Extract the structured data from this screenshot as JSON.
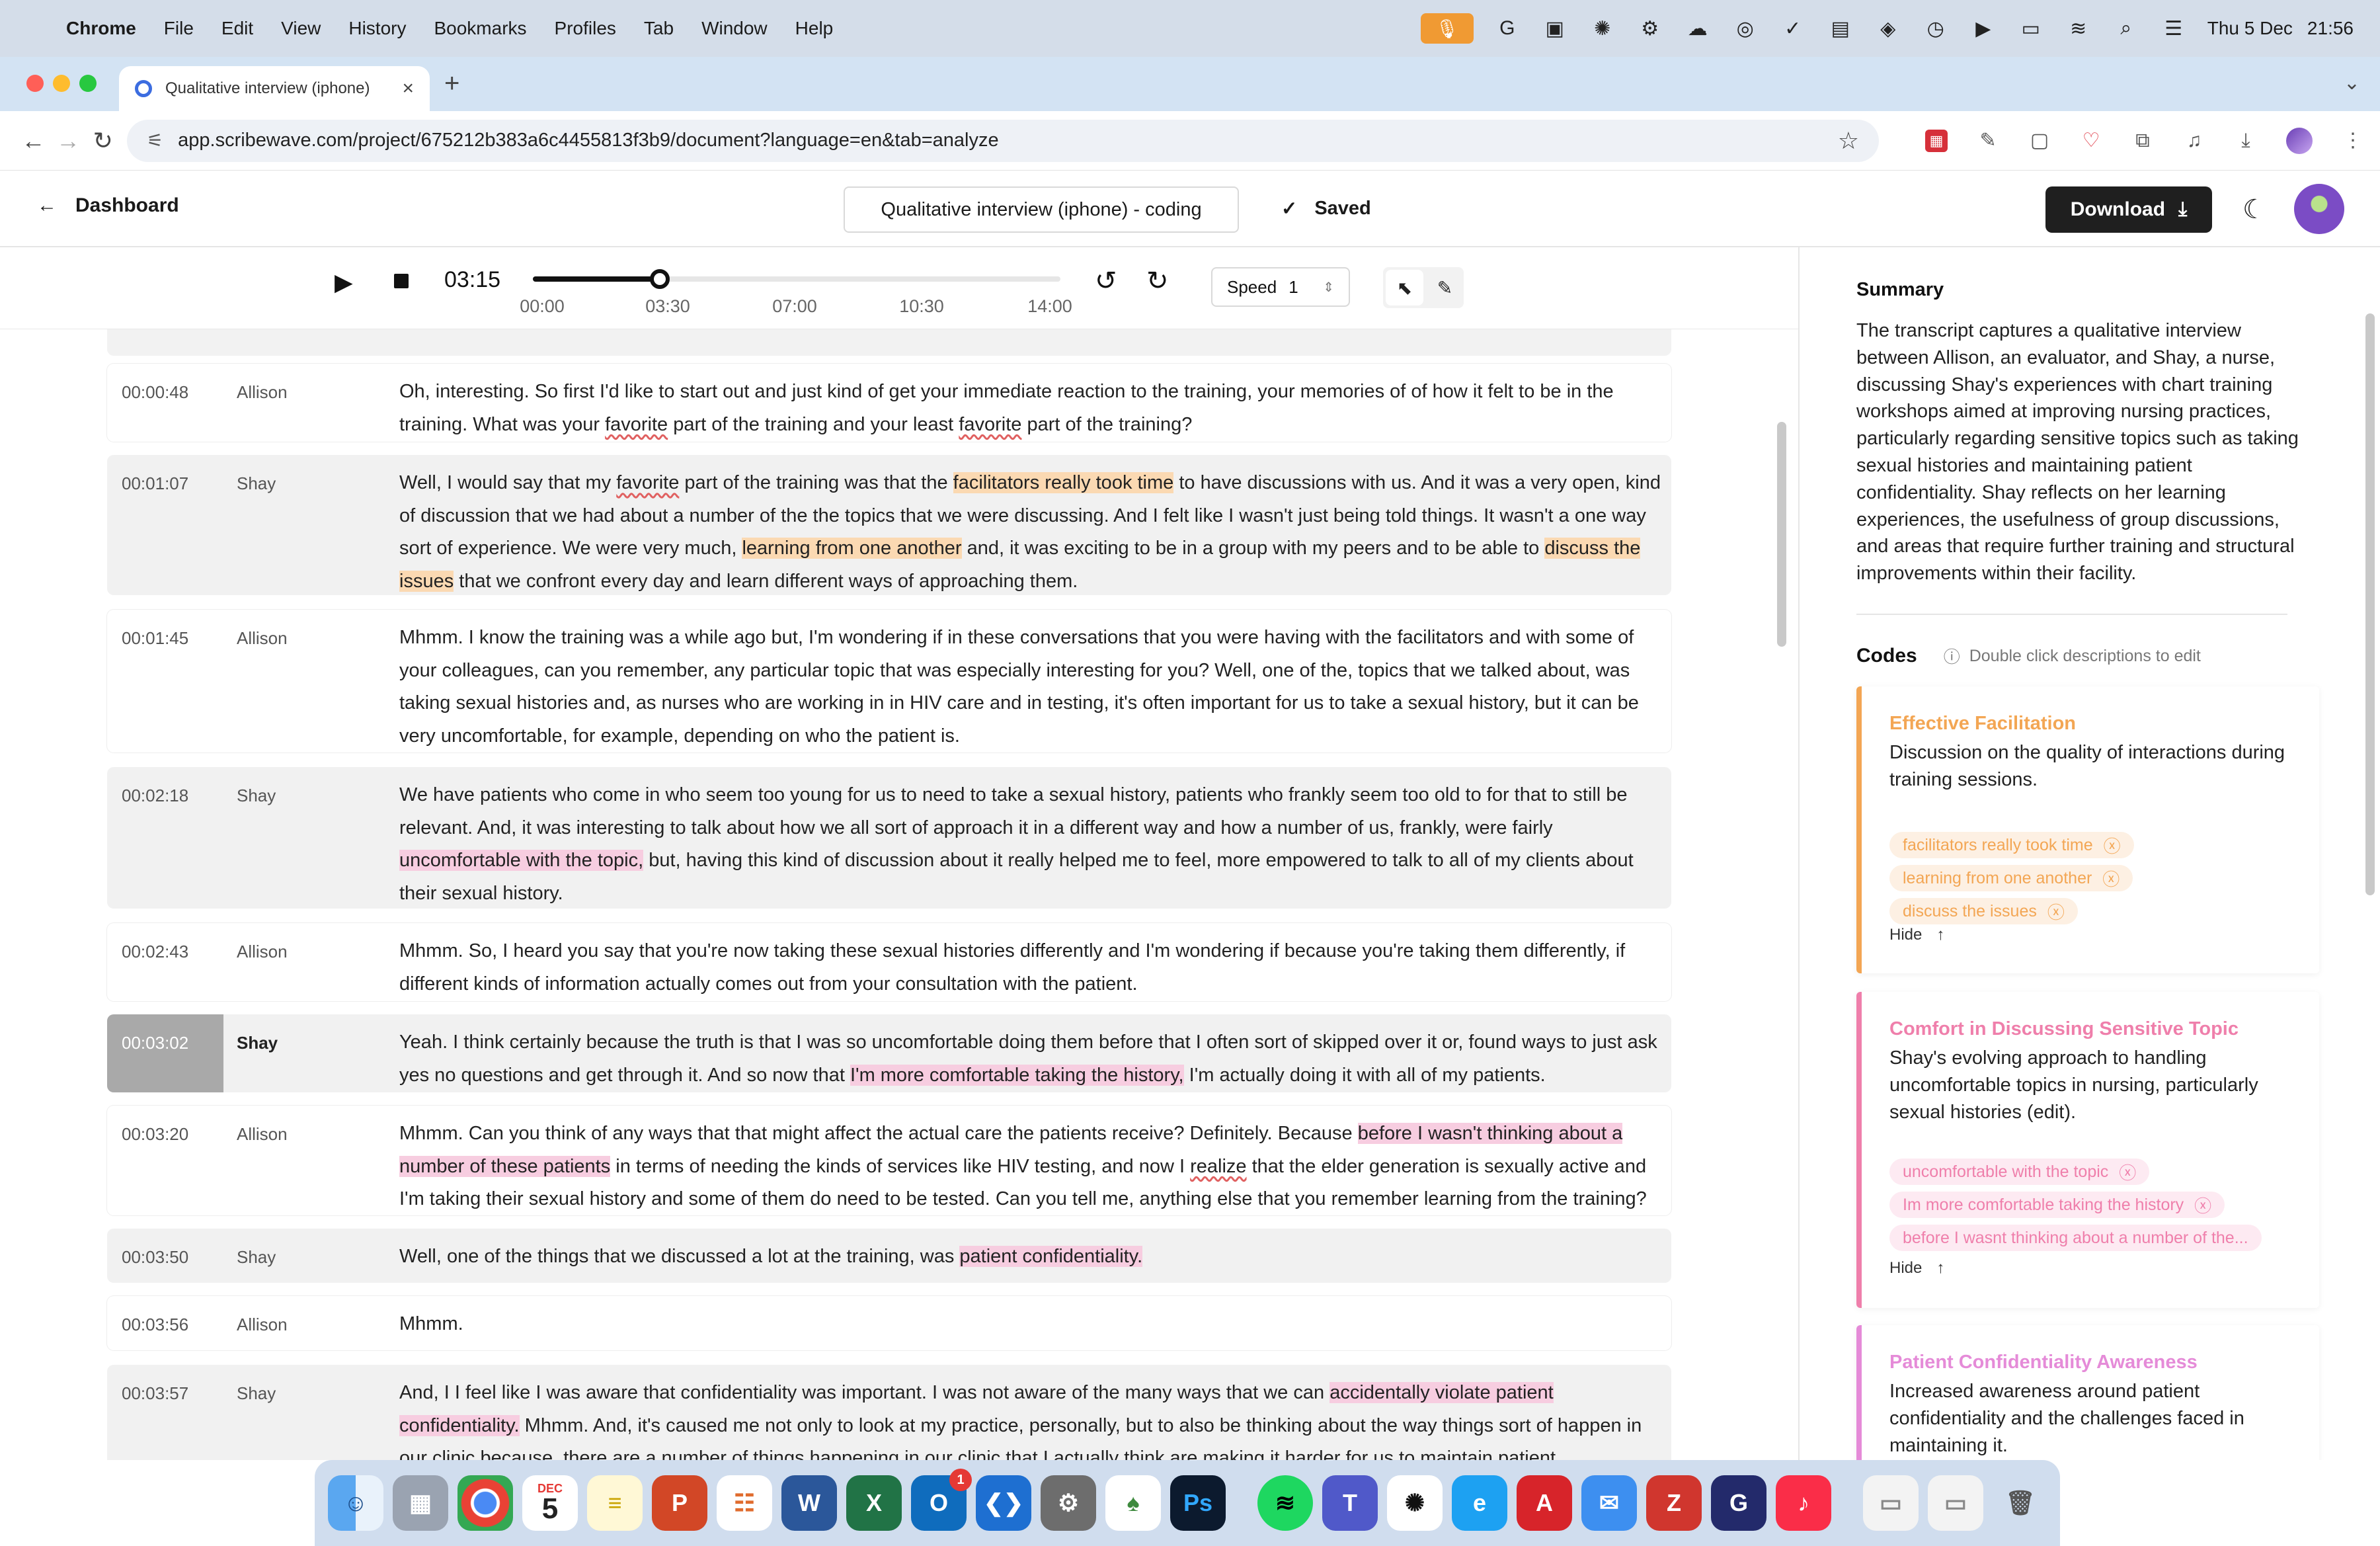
{
  "menubar": {
    "app": "Chrome",
    "items": [
      "File",
      "Edit",
      "View",
      "History",
      "Bookmarks",
      "Profiles",
      "Tab",
      "Window",
      "Help"
    ],
    "date": "Thu 5 Dec",
    "time": "21:56"
  },
  "browser": {
    "tab_title": "Qualitative interview (iphone)",
    "url": "app.scribewave.com/project/675212b383a6c4455813f3b9/document?language=en&tab=analyze"
  },
  "header": {
    "back_label": "Dashboard",
    "doc_title": "Qualitative interview (iphone) - coding",
    "saved_label": "Saved",
    "download_label": "Download"
  },
  "player": {
    "current_time": "03:15",
    "progress": 0.24,
    "ticks": [
      "00:00",
      "03:30",
      "07:00",
      "10:30",
      "14:00"
    ],
    "speed_label": "Speed",
    "speed_value": "1"
  },
  "transcript": [
    {
      "time": "00:00:48",
      "speaker": "Allison"
    },
    {
      "time": "00:01:07",
      "speaker": "Shay"
    },
    {
      "time": "00:01:45",
      "speaker": "Allison"
    },
    {
      "time": "00:02:18",
      "speaker": "Shay"
    },
    {
      "time": "00:02:43",
      "speaker": "Allison"
    },
    {
      "time": "00:03:02",
      "speaker": "Shay"
    },
    {
      "time": "00:03:20",
      "speaker": "Allison"
    },
    {
      "time": "00:03:50",
      "speaker": "Shay"
    },
    {
      "time": "00:03:56",
      "speaker": "Allison"
    },
    {
      "time": "00:03:57",
      "speaker": "Shay"
    }
  ],
  "t": {
    "r0": "Oh, interesting. So first I'd like to start out and just kind of get your immediate reaction to the training, your memories of of how it felt to be in the training. What was your ",
    "r0b": " part of the training and your least ",
    "r0c": " part of the training?",
    "favorite": "favorite",
    "r1a": "Well, I would say that my ",
    "r1b": " part of the training was that the ",
    "r1c": " to have discussions with us. And it was a very open, kind of discussion that we had about a number of the the topics that we were discussing. And I felt like I wasn't just being told things. It wasn't a one way sort of experience. We were very much, ",
    "r1d": " and, it was exciting to be in a group with my peers and to be able to ",
    "r1e": " that we confront every day and learn different ways of approaching them.",
    "hl_facilitators": "facilitators really took time",
    "hl_learning": "learning from one another",
    "hl_discuss": "discuss the issues",
    "r2": "Mhmm. I know the training was a while ago but, I'm wondering if in these conversations that you were having with the facilitators and with some of your colleagues, can you remember, any particular topic that was especially interesting for you? Well, one of the, topics that we talked about, was taking sexual histories and, as nurses who are working in in HIV care and in testing, it's often important for us to take a sexual history, but it can be very uncomfortable, for example, depending on who the patient is.",
    "r3a": "We have patients who come in who seem too young for us to need to take a sexual history, patients who frankly seem too old to for that to still be relevant. And, it was interesting to talk about how we all sort of approach it in a different way and how a number of us, frankly, were fairly ",
    "hl_uncomf": "uncomfortable with the topic,",
    "r3b": " but, having this kind of discussion about it really helped me to feel, more empowered to talk to all of my clients about their sexual history.",
    "r4": "Mhmm. So, I heard you say that you're now taking these sexual histories differently and I'm wondering if because you're taking them differently, if different kinds of information actually comes out from your consultation with the patient.",
    "r5a": "Yeah. I think certainly because the truth is that I was so uncomfortable doing them before that I often sort of skipped over it or, found ways to just ask yes no questions and get through it. And so now that ",
    "hl_comfortable": "I'm more comfortable taking the history,",
    "r5b": " I'm actually doing it with all of my patients.",
    "r6a": "Mhmm. Can you think of any ways that that might affect the actual care the patients receive? Definitely. Because ",
    "hl_before": "before I wasn't thinking about a number of these patients",
    "r6b": " in terms of needing the kinds of services like HIV testing, and now I ",
    "realize": "realize",
    "r6c": " that the elder generation is sexually active and I'm taking their sexual history and some of them do need to be tested. Can you tell me, anything else that you remember learning from the training?",
    "r7a": "Well, one of the things that we discussed a lot at the training, was ",
    "hl_conf": "patient confidentiality.",
    "r8": "Mhmm.",
    "r9a": "And, I I feel like I was aware that confidentiality was important. I was not aware of the many ways that we can ",
    "hl_violate": "accidentally violate patient confidentiality.",
    "r9b": " Mhmm. And, it's caused me not only to look at my practice, personally, but to also be thinking about the way things sort of happen in our clinic because, there are a number of things happening in our clinic that I actually think are making it harder for us to maintain patient"
  },
  "summary": {
    "heading": "Summary",
    "text": "The transcript captures a qualitative interview between Allison, an evaluator, and Shay, a nurse, discussing Shay's experiences with chart training workshops aimed at improving nursing practices, particularly regarding sensitive topics such as taking sexual histories and maintaining patient confidentiality. Shay reflects on her learning experiences, the usefulness of group discussions, and areas that require further training and structural improvements within their facility."
  },
  "codes": {
    "heading": "Codes",
    "hint": "Double click descriptions to edit",
    "hide_label": "Hide",
    "items": [
      {
        "name": "Effective Facilitation",
        "color": "#f3a654",
        "description": "Discussion on the quality of interactions during training sessions.",
        "tags": [
          "facilitators really took time",
          "learning from one another",
          "discuss the issues"
        ]
      },
      {
        "name": "Comfort in Discussing Sensitive Topic",
        "color": "#ef7fab",
        "description": "Shay's evolving approach to handling uncomfortable topics in nursing, particularly sexual histories (edit).",
        "tags": [
          "uncomfortable with the topic",
          "Im more comfortable taking the history",
          "before I wasnt thinking about a number of the..."
        ]
      },
      {
        "name": "Patient Confidentiality Awareness",
        "color": "#e58bd8",
        "description": "Increased awareness around patient confidentiality and the challenges faced in maintaining it."
      }
    ]
  },
  "dock": {
    "calendar_month": "DEC",
    "calendar_day": "5",
    "outlook_badge": "1"
  },
  "colors": {
    "highlight_orange": "#fbd9b2",
    "highlight_pink": "#f7cde0",
    "download_button": "#1f1f1f"
  }
}
